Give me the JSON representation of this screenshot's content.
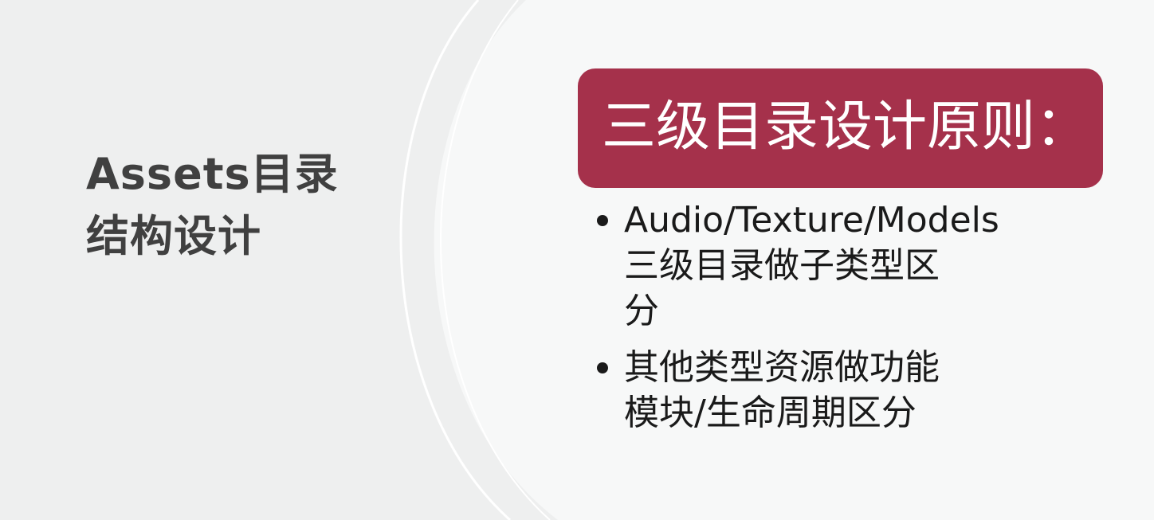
{
  "left_title": {
    "lines": [
      "Assets目录",
      "结构设计"
    ]
  },
  "header": {
    "text": "三级目录设计原则："
  },
  "bullets": [
    {
      "lines": [
        "Audio/Texture/Models",
        "三级目录做子类型区",
        "分"
      ]
    },
    {
      "lines": [
        "其他类型资源做功能",
        "模块/生命周期区分"
      ]
    }
  ],
  "colors": {
    "background": "#eeefef",
    "panel": "#f7f8f8",
    "accent": "#a5314b",
    "title_text": "#404040",
    "body_text": "#1a1a1a"
  }
}
